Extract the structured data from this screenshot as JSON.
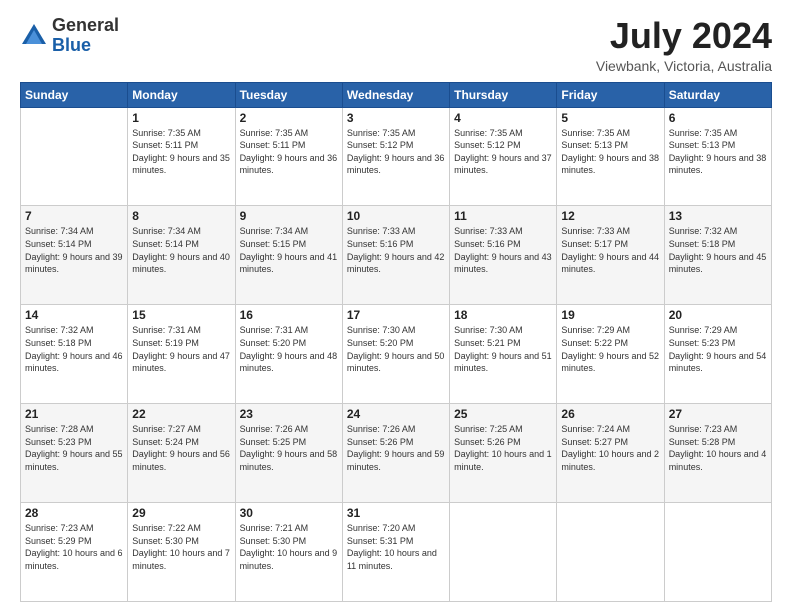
{
  "header": {
    "logo_general": "General",
    "logo_blue": "Blue",
    "month_title": "July 2024",
    "location": "Viewbank, Victoria, Australia"
  },
  "days_of_week": [
    "Sunday",
    "Monday",
    "Tuesday",
    "Wednesday",
    "Thursday",
    "Friday",
    "Saturday"
  ],
  "weeks": [
    [
      {
        "day": "",
        "sunrise": "",
        "sunset": "",
        "daylight": ""
      },
      {
        "day": "1",
        "sunrise": "Sunrise: 7:35 AM",
        "sunset": "Sunset: 5:11 PM",
        "daylight": "Daylight: 9 hours and 35 minutes."
      },
      {
        "day": "2",
        "sunrise": "Sunrise: 7:35 AM",
        "sunset": "Sunset: 5:11 PM",
        "daylight": "Daylight: 9 hours and 36 minutes."
      },
      {
        "day": "3",
        "sunrise": "Sunrise: 7:35 AM",
        "sunset": "Sunset: 5:12 PM",
        "daylight": "Daylight: 9 hours and 36 minutes."
      },
      {
        "day": "4",
        "sunrise": "Sunrise: 7:35 AM",
        "sunset": "Sunset: 5:12 PM",
        "daylight": "Daylight: 9 hours and 37 minutes."
      },
      {
        "day": "5",
        "sunrise": "Sunrise: 7:35 AM",
        "sunset": "Sunset: 5:13 PM",
        "daylight": "Daylight: 9 hours and 38 minutes."
      },
      {
        "day": "6",
        "sunrise": "Sunrise: 7:35 AM",
        "sunset": "Sunset: 5:13 PM",
        "daylight": "Daylight: 9 hours and 38 minutes."
      }
    ],
    [
      {
        "day": "7",
        "sunrise": "Sunrise: 7:34 AM",
        "sunset": "Sunset: 5:14 PM",
        "daylight": "Daylight: 9 hours and 39 minutes."
      },
      {
        "day": "8",
        "sunrise": "Sunrise: 7:34 AM",
        "sunset": "Sunset: 5:14 PM",
        "daylight": "Daylight: 9 hours and 40 minutes."
      },
      {
        "day": "9",
        "sunrise": "Sunrise: 7:34 AM",
        "sunset": "Sunset: 5:15 PM",
        "daylight": "Daylight: 9 hours and 41 minutes."
      },
      {
        "day": "10",
        "sunrise": "Sunrise: 7:33 AM",
        "sunset": "Sunset: 5:16 PM",
        "daylight": "Daylight: 9 hours and 42 minutes."
      },
      {
        "day": "11",
        "sunrise": "Sunrise: 7:33 AM",
        "sunset": "Sunset: 5:16 PM",
        "daylight": "Daylight: 9 hours and 43 minutes."
      },
      {
        "day": "12",
        "sunrise": "Sunrise: 7:33 AM",
        "sunset": "Sunset: 5:17 PM",
        "daylight": "Daylight: 9 hours and 44 minutes."
      },
      {
        "day": "13",
        "sunrise": "Sunrise: 7:32 AM",
        "sunset": "Sunset: 5:18 PM",
        "daylight": "Daylight: 9 hours and 45 minutes."
      }
    ],
    [
      {
        "day": "14",
        "sunrise": "Sunrise: 7:32 AM",
        "sunset": "Sunset: 5:18 PM",
        "daylight": "Daylight: 9 hours and 46 minutes."
      },
      {
        "day": "15",
        "sunrise": "Sunrise: 7:31 AM",
        "sunset": "Sunset: 5:19 PM",
        "daylight": "Daylight: 9 hours and 47 minutes."
      },
      {
        "day": "16",
        "sunrise": "Sunrise: 7:31 AM",
        "sunset": "Sunset: 5:20 PM",
        "daylight": "Daylight: 9 hours and 48 minutes."
      },
      {
        "day": "17",
        "sunrise": "Sunrise: 7:30 AM",
        "sunset": "Sunset: 5:20 PM",
        "daylight": "Daylight: 9 hours and 50 minutes."
      },
      {
        "day": "18",
        "sunrise": "Sunrise: 7:30 AM",
        "sunset": "Sunset: 5:21 PM",
        "daylight": "Daylight: 9 hours and 51 minutes."
      },
      {
        "day": "19",
        "sunrise": "Sunrise: 7:29 AM",
        "sunset": "Sunset: 5:22 PM",
        "daylight": "Daylight: 9 hours and 52 minutes."
      },
      {
        "day": "20",
        "sunrise": "Sunrise: 7:29 AM",
        "sunset": "Sunset: 5:23 PM",
        "daylight": "Daylight: 9 hours and 54 minutes."
      }
    ],
    [
      {
        "day": "21",
        "sunrise": "Sunrise: 7:28 AM",
        "sunset": "Sunset: 5:23 PM",
        "daylight": "Daylight: 9 hours and 55 minutes."
      },
      {
        "day": "22",
        "sunrise": "Sunrise: 7:27 AM",
        "sunset": "Sunset: 5:24 PM",
        "daylight": "Daylight: 9 hours and 56 minutes."
      },
      {
        "day": "23",
        "sunrise": "Sunrise: 7:26 AM",
        "sunset": "Sunset: 5:25 PM",
        "daylight": "Daylight: 9 hours and 58 minutes."
      },
      {
        "day": "24",
        "sunrise": "Sunrise: 7:26 AM",
        "sunset": "Sunset: 5:26 PM",
        "daylight": "Daylight: 9 hours and 59 minutes."
      },
      {
        "day": "25",
        "sunrise": "Sunrise: 7:25 AM",
        "sunset": "Sunset: 5:26 PM",
        "daylight": "Daylight: 10 hours and 1 minute."
      },
      {
        "day": "26",
        "sunrise": "Sunrise: 7:24 AM",
        "sunset": "Sunset: 5:27 PM",
        "daylight": "Daylight: 10 hours and 2 minutes."
      },
      {
        "day": "27",
        "sunrise": "Sunrise: 7:23 AM",
        "sunset": "Sunset: 5:28 PM",
        "daylight": "Daylight: 10 hours and 4 minutes."
      }
    ],
    [
      {
        "day": "28",
        "sunrise": "Sunrise: 7:23 AM",
        "sunset": "Sunset: 5:29 PM",
        "daylight": "Daylight: 10 hours and 6 minutes."
      },
      {
        "day": "29",
        "sunrise": "Sunrise: 7:22 AM",
        "sunset": "Sunset: 5:30 PM",
        "daylight": "Daylight: 10 hours and 7 minutes."
      },
      {
        "day": "30",
        "sunrise": "Sunrise: 7:21 AM",
        "sunset": "Sunset: 5:30 PM",
        "daylight": "Daylight: 10 hours and 9 minutes."
      },
      {
        "day": "31",
        "sunrise": "Sunrise: 7:20 AM",
        "sunset": "Sunset: 5:31 PM",
        "daylight": "Daylight: 10 hours and 11 minutes."
      },
      {
        "day": "",
        "sunrise": "",
        "sunset": "",
        "daylight": ""
      },
      {
        "day": "",
        "sunrise": "",
        "sunset": "",
        "daylight": ""
      },
      {
        "day": "",
        "sunrise": "",
        "sunset": "",
        "daylight": ""
      }
    ]
  ]
}
